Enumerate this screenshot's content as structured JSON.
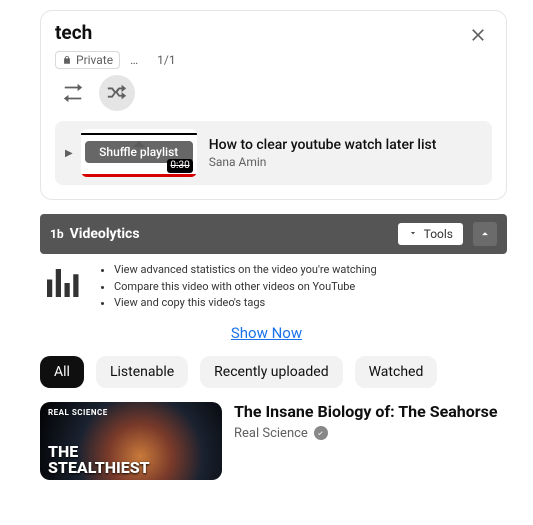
{
  "playlist": {
    "title": "tech",
    "privacy_label": "Private",
    "meta_ellipsis": "…",
    "index_label": "1/1",
    "shuffle_tooltip": "Shuffle playlist",
    "item": {
      "title": "How to clear youtube watch later list",
      "author": "Sana Amin",
      "duration": "0:30"
    }
  },
  "videolytics": {
    "brand": "Videolytics",
    "brand_prefix": "1b",
    "tools_label": "Tools",
    "bullets": [
      "View advanced statistics on the video you're watching",
      "Compare this video with other videos on YouTube",
      "View and copy this video's tags"
    ],
    "show_now": "Show Now"
  },
  "filters": {
    "all": "All",
    "listenable": "Listenable",
    "recent": "Recently uploaded",
    "watched": "Watched"
  },
  "video": {
    "title": "The Insane Biology of: The Seahorse",
    "channel": "Real Science",
    "thumb_channel_tag": "REAL SCIENCE",
    "thumb_overlay_line1": "THE",
    "thumb_overlay_line2": "STEALTHIEST"
  }
}
